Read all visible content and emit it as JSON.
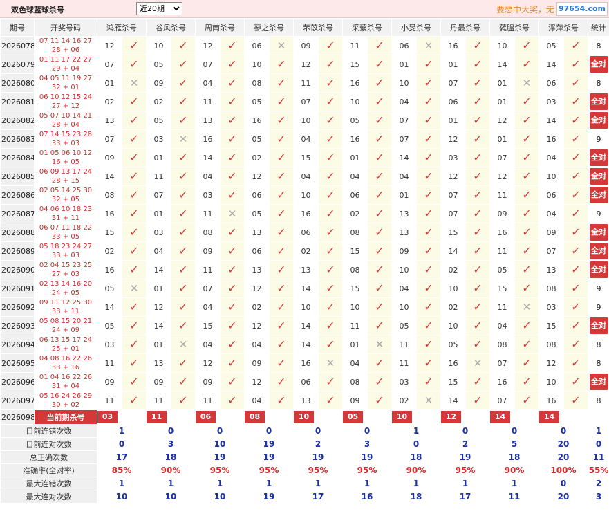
{
  "header": {
    "title": "双色球蓝球杀号",
    "period_select": {
      "value": "近20期",
      "options": [
        "近20期"
      ]
    },
    "promo": "要想中大奖，无",
    "watermark": "97654.com"
  },
  "columns": {
    "issue": "期号",
    "winning": "开奖号码",
    "experts": [
      "鸿雁杀号",
      "谷风杀号",
      "周南杀号",
      "蓼之杀号",
      "芣苡杀号",
      "采蘩杀号",
      "小旻杀号",
      "丹最杀号",
      "蕤膃杀号",
      "浮萍杀号"
    ],
    "stat": "统计"
  },
  "status_text": {
    "all_correct": "全对"
  },
  "colors": {
    "accent_red": "#d43838",
    "check_red": "#d43c3c",
    "cross_gray": "#aaaaaa",
    "stat_blue": "#1a2fa8"
  },
  "rows": [
    {
      "issue": "2026078",
      "win1": "07 11 14 16 27",
      "win2": "28 + 06",
      "picks": [
        "12",
        "10",
        "12",
        "06",
        "09",
        "11",
        "06",
        "16",
        "10",
        "05"
      ],
      "results": [
        1,
        1,
        1,
        0,
        1,
        1,
        0,
        1,
        1,
        1
      ],
      "stat": "8"
    },
    {
      "issue": "2026079",
      "win1": "01 11 17 22 27",
      "win2": "29 + 04",
      "picks": [
        "07",
        "05",
        "07",
        "10",
        "12",
        "15",
        "01",
        "01",
        "14",
        "14"
      ],
      "results": [
        1,
        1,
        1,
        1,
        1,
        1,
        1,
        1,
        1,
        1
      ],
      "stat": "全对"
    },
    {
      "issue": "2026080",
      "win1": "04 05 11 19 27",
      "win2": "32 + 01",
      "picks": [
        "01",
        "09",
        "04",
        "08",
        "11",
        "16",
        "10",
        "07",
        "01",
        "06"
      ],
      "results": [
        0,
        1,
        1,
        1,
        1,
        1,
        1,
        1,
        0,
        1
      ],
      "stat": "8"
    },
    {
      "issue": "2026081",
      "win1": "06 10 12 15 24",
      "win2": "27 + 12",
      "picks": [
        "02",
        "02",
        "11",
        "05",
        "07",
        "10",
        "04",
        "06",
        "01",
        "03"
      ],
      "results": [
        1,
        1,
        1,
        1,
        1,
        1,
        1,
        1,
        1,
        1
      ],
      "stat": "全对"
    },
    {
      "issue": "2026082",
      "win1": "05 07 10 14 21",
      "win2": "28 + 04",
      "picks": [
        "13",
        "05",
        "13",
        "16",
        "10",
        "05",
        "07",
        "01",
        "12",
        "14"
      ],
      "results": [
        1,
        1,
        1,
        1,
        1,
        1,
        1,
        1,
        1,
        1
      ],
      "stat": "全对"
    },
    {
      "issue": "2026083",
      "win1": "07 14 15 23 28",
      "win2": "33 + 03",
      "picks": [
        "07",
        "03",
        "16",
        "05",
        "04",
        "16",
        "07",
        "12",
        "01",
        "16"
      ],
      "results": [
        1,
        0,
        1,
        1,
        1,
        1,
        1,
        1,
        1,
        1
      ],
      "stat": "9"
    },
    {
      "issue": "2026084",
      "win1": "01 05 06 10 12",
      "win2": "16 + 05",
      "picks": [
        "09",
        "01",
        "14",
        "02",
        "15",
        "01",
        "14",
        "03",
        "07",
        "04"
      ],
      "results": [
        1,
        1,
        1,
        1,
        1,
        1,
        1,
        1,
        1,
        1
      ],
      "stat": "全对"
    },
    {
      "issue": "2026085",
      "win1": "06 09 13 17 24",
      "win2": "28 + 15",
      "picks": [
        "14",
        "11",
        "04",
        "12",
        "04",
        "04",
        "04",
        "12",
        "12",
        "10"
      ],
      "results": [
        1,
        1,
        1,
        1,
        1,
        1,
        1,
        1,
        1,
        1
      ],
      "stat": "全对"
    },
    {
      "issue": "2026086",
      "win1": "02 05 14 25 30",
      "win2": "32 + 05",
      "picks": [
        "08",
        "07",
        "03",
        "06",
        "10",
        "06",
        "01",
        "07",
        "11",
        "06"
      ],
      "results": [
        1,
        1,
        1,
        1,
        1,
        1,
        1,
        1,
        1,
        1
      ],
      "stat": "全对"
    },
    {
      "issue": "2026087",
      "win1": "04 06 10 18 23",
      "win2": "31 + 11",
      "picks": [
        "16",
        "01",
        "11",
        "05",
        "16",
        "02",
        "13",
        "07",
        "09",
        "04"
      ],
      "results": [
        1,
        1,
        0,
        1,
        1,
        1,
        1,
        1,
        1,
        1
      ],
      "stat": "9"
    },
    {
      "issue": "2026088",
      "win1": "06 07 11 18 22",
      "win2": "33 + 05",
      "picks": [
        "15",
        "03",
        "08",
        "13",
        "06",
        "08",
        "13",
        "15",
        "16",
        "09"
      ],
      "results": [
        1,
        1,
        1,
        1,
        1,
        1,
        1,
        1,
        1,
        1
      ],
      "stat": "全对"
    },
    {
      "issue": "2026089",
      "win1": "05 18 23 24 27",
      "win2": "33 + 03",
      "picks": [
        "02",
        "04",
        "09",
        "06",
        "02",
        "15",
        "09",
        "14",
        "11",
        "07"
      ],
      "results": [
        1,
        1,
        1,
        1,
        1,
        1,
        1,
        1,
        1,
        1
      ],
      "stat": "全对"
    },
    {
      "issue": "2026090",
      "win1": "02 04 15 23 25",
      "win2": "27 + 03",
      "picks": [
        "16",
        "14",
        "11",
        "13",
        "13",
        "08",
        "10",
        "02",
        "05",
        "13"
      ],
      "results": [
        1,
        1,
        1,
        1,
        1,
        1,
        1,
        1,
        1,
        1
      ],
      "stat": "全对"
    },
    {
      "issue": "2026091",
      "win1": "02 13 14 16 20",
      "win2": "24 + 05",
      "picks": [
        "05",
        "01",
        "07",
        "12",
        "14",
        "15",
        "04",
        "10",
        "15",
        "08"
      ],
      "results": [
        0,
        1,
        1,
        1,
        1,
        1,
        1,
        1,
        1,
        1
      ],
      "stat": "9"
    },
    {
      "issue": "2026092",
      "win1": "09 11 12 25 30",
      "win2": "33 + 11",
      "picks": [
        "14",
        "12",
        "04",
        "02",
        "10",
        "10",
        "10",
        "02",
        "11",
        "03"
      ],
      "results": [
        1,
        1,
        1,
        1,
        1,
        1,
        1,
        1,
        0,
        1
      ],
      "stat": "9"
    },
    {
      "issue": "2026093",
      "win1": "05 08 15 20 21",
      "win2": "24 + 09",
      "picks": [
        "05",
        "14",
        "15",
        "12",
        "14",
        "11",
        "05",
        "10",
        "04",
        "15"
      ],
      "results": [
        1,
        1,
        1,
        1,
        1,
        1,
        1,
        1,
        1,
        1
      ],
      "stat": "全对"
    },
    {
      "issue": "2026094",
      "win1": "06 13 15 17 24",
      "win2": "25 + 01",
      "picks": [
        "03",
        "01",
        "04",
        "04",
        "14",
        "01",
        "11",
        "05",
        "08",
        "08"
      ],
      "results": [
        1,
        0,
        1,
        1,
        1,
        0,
        1,
        1,
        1,
        1
      ],
      "stat": "8"
    },
    {
      "issue": "2026095",
      "win1": "04 08 16 22 26",
      "win2": "33 + 16",
      "picks": [
        "11",
        "13",
        "12",
        "09",
        "16",
        "04",
        "11",
        "16",
        "07",
        "12"
      ],
      "results": [
        1,
        1,
        1,
        1,
        0,
        1,
        1,
        0,
        1,
        1
      ],
      "stat": "8"
    },
    {
      "issue": "2026096",
      "win1": "01 04 16 22 26",
      "win2": "31 + 04",
      "picks": [
        "09",
        "09",
        "09",
        "12",
        "06",
        "08",
        "03",
        "15",
        "16",
        "10"
      ],
      "results": [
        1,
        1,
        1,
        1,
        1,
        1,
        1,
        1,
        1,
        1
      ],
      "stat": "全对"
    },
    {
      "issue": "2026097",
      "win1": "05 16 24 26 29",
      "win2": "30 + 02",
      "picks": [
        "11",
        "11",
        "11",
        "04",
        "13",
        "09",
        "02",
        "14",
        "07",
        "16"
      ],
      "results": [
        1,
        1,
        1,
        1,
        1,
        1,
        0,
        1,
        1,
        1
      ],
      "stat": "8"
    }
  ],
  "current": {
    "issue": "2026098",
    "label": "当前期杀号",
    "picks": [
      "03",
      "11",
      "06",
      "08",
      "10",
      "05",
      "10",
      "12",
      "14",
      "14"
    ]
  },
  "summary": [
    {
      "label": "目前连错次数",
      "values": [
        "1",
        "0",
        "0",
        "0",
        "0",
        "0",
        "1",
        "0",
        "0",
        "0"
      ],
      "total": "1",
      "pct": false
    },
    {
      "label": "目前连对次数",
      "values": [
        "0",
        "3",
        "10",
        "19",
        "2",
        "3",
        "0",
        "2",
        "5",
        "20"
      ],
      "total": "0",
      "pct": false
    },
    {
      "label": "总正确次数",
      "values": [
        "17",
        "18",
        "19",
        "19",
        "19",
        "19",
        "18",
        "19",
        "18",
        "20"
      ],
      "total": "11",
      "pct": false
    },
    {
      "label": "准确率(全对率)",
      "values": [
        "85%",
        "90%",
        "95%",
        "95%",
        "95%",
        "95%",
        "90%",
        "95%",
        "90%",
        "100%"
      ],
      "total": "55%",
      "pct": true
    },
    {
      "label": "最大连错次数",
      "values": [
        "1",
        "1",
        "1",
        "1",
        "1",
        "1",
        "1",
        "1",
        "1",
        "0"
      ],
      "total": "2",
      "pct": false
    },
    {
      "label": "最大连对次数",
      "values": [
        "10",
        "10",
        "10",
        "19",
        "17",
        "16",
        "18",
        "17",
        "11",
        "20"
      ],
      "total": "3",
      "pct": false
    }
  ]
}
